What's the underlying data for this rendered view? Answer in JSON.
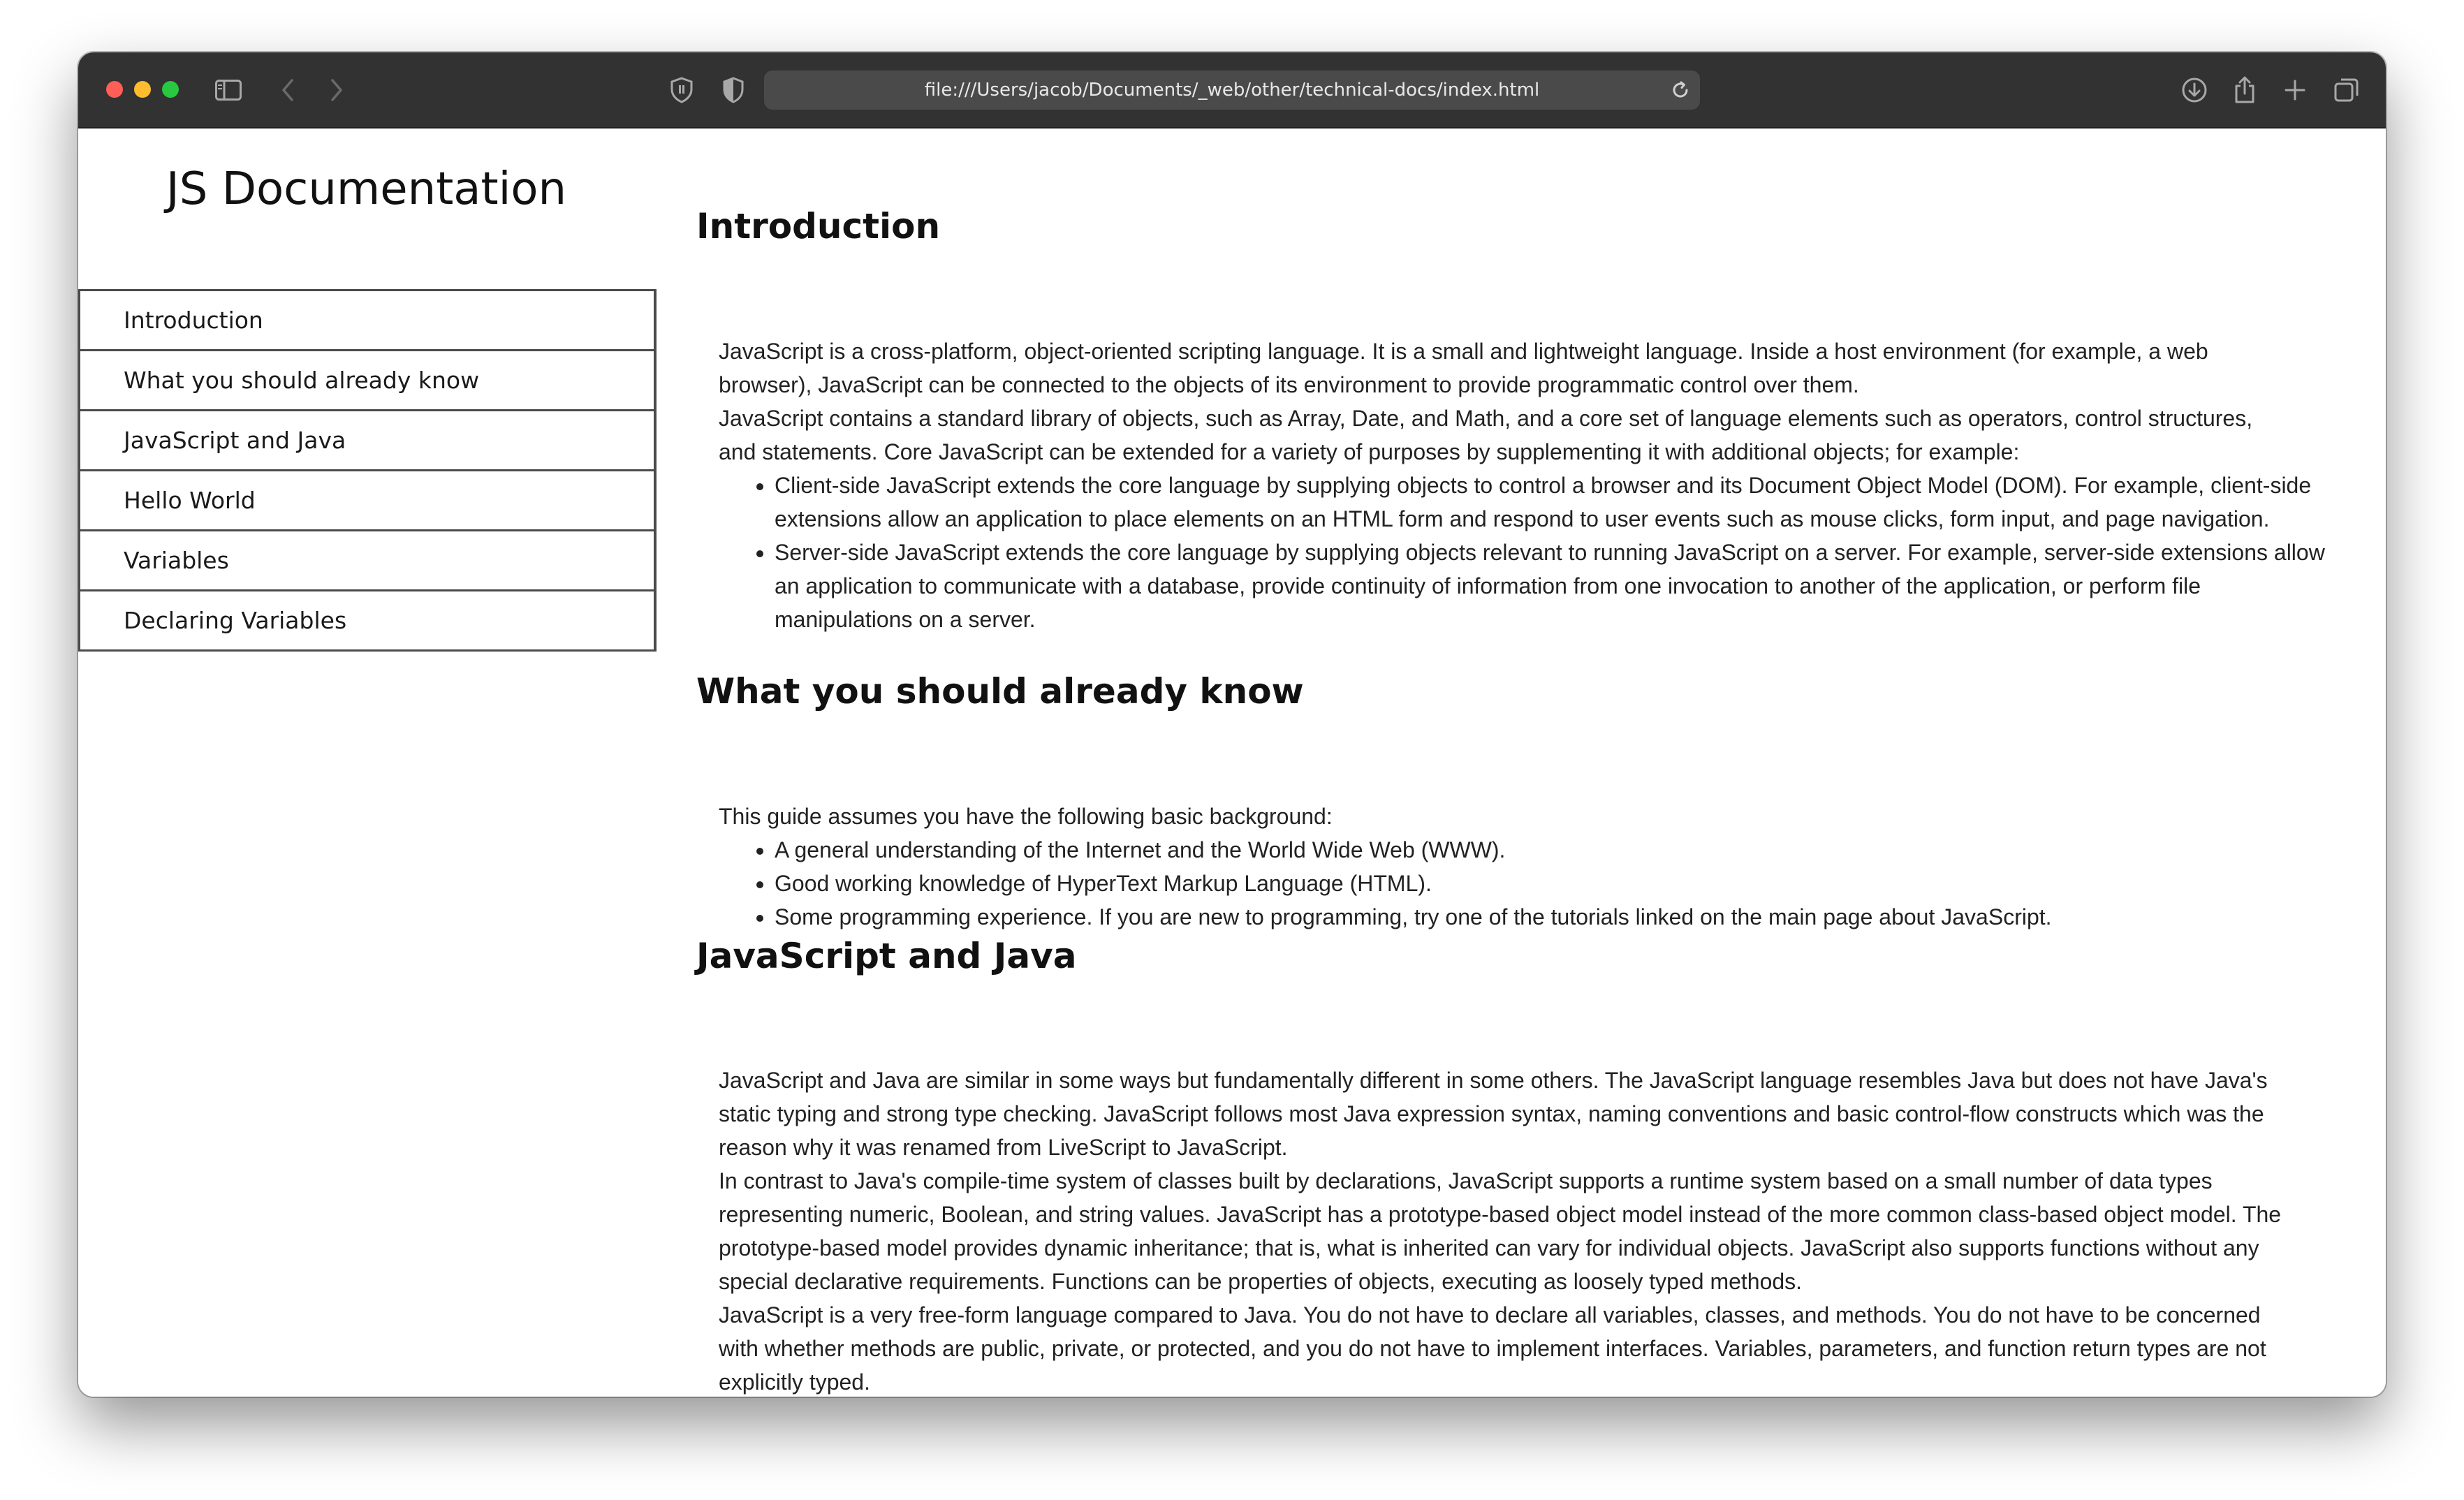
{
  "browser": {
    "url": "file:///Users/jacob/Documents/_web/other/technical-docs/index.html",
    "colors": {
      "close": "#ff5f57",
      "minimize": "#febc2e",
      "zoom": "#28c840"
    }
  },
  "sidebar": {
    "title": "JS Documentation",
    "items": [
      "Introduction",
      "What you should already know",
      "JavaScript and Java",
      "Hello World",
      "Variables",
      "Declaring Variables"
    ]
  },
  "sections": {
    "introduction": {
      "title": "Introduction",
      "paragraphs": [
        "JavaScript is a cross-platform, object-oriented scripting language. It is a small and lightweight language. Inside a host environment (for example, a web browser), JavaScript can be connected to the objects of its environment to provide programmatic control over them.",
        "JavaScript contains a standard library of objects, such as Array, Date, and Math, and a core set of language elements such as operators, control structures, and statements. Core JavaScript can be extended for a variety of purposes by supplementing it with additional objects; for example:"
      ],
      "bullets": [
        "Client-side JavaScript extends the core language by supplying objects to control a browser and its Document Object Model (DOM). For example, client-side extensions allow an application to place elements on an HTML form and respond to user events such as mouse clicks, form input, and page navigation.",
        "Server-side JavaScript extends the core language by supplying objects relevant to running JavaScript on a server. For example, server-side extensions allow an application to communicate with a database, provide continuity of information from one invocation to another of the application, or perform file manipulations on a server."
      ]
    },
    "know": {
      "title": "What you should already know",
      "paragraphs": [
        "This guide assumes you have the following basic background:"
      ],
      "bullets": [
        "A general understanding of the Internet and the World Wide Web (WWW).",
        "Good working knowledge of HyperText Markup Language (HTML).",
        "Some programming experience. If you are new to programming, try one of the tutorials linked on the main page about JavaScript."
      ]
    },
    "java": {
      "title": "JavaScript and Java",
      "paragraphs": [
        "JavaScript and Java are similar in some ways but fundamentally different in some others. The JavaScript language resembles Java but does not have Java's static typing and strong type checking. JavaScript follows most Java expression syntax, naming conventions and basic control-flow constructs which was the reason why it was renamed from LiveScript to JavaScript.",
        "In contrast to Java's compile-time system of classes built by declarations, JavaScript supports a runtime system based on a small number of data types representing numeric, Boolean, and string values. JavaScript has a prototype-based object model instead of the more common class-based object model. The prototype-based model provides dynamic inheritance; that is, what is inherited can vary for individual objects. JavaScript also supports functions without any special declarative requirements. Functions can be properties of objects, executing as loosely typed methods.",
        "JavaScript is a very free-form language compared to Java. You do not have to declare all variables, classes, and methods. You do not have to be concerned with whether methods are public, private, or protected, and you do not have to implement interfaces. Variables, parameters, and function return types are not explicitly typed."
      ]
    }
  }
}
